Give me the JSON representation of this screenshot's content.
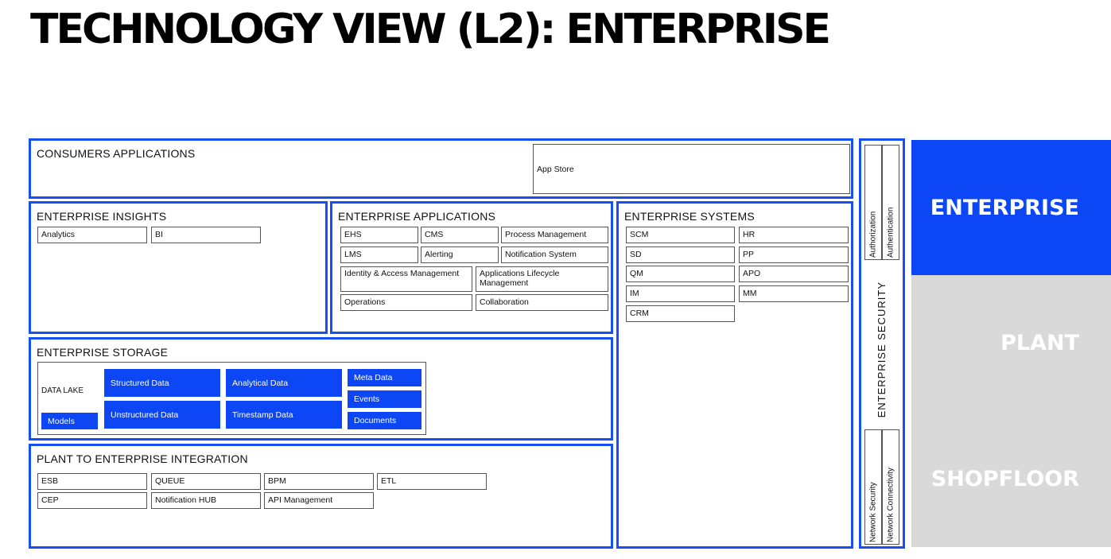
{
  "title": "TECHNOLOGY VIEW (L2): ENTERPRISE",
  "colors": {
    "accent": "#1550f0",
    "filled_block": "#0d47f5",
    "inactive_band": "#d9d9d9"
  },
  "consumers": {
    "title": "CONSUMERS APPLICATIONS",
    "app_store": "App Store"
  },
  "insights": {
    "title": "ENTERPRISE INSIGHTS",
    "items": [
      "Analytics",
      "BI"
    ]
  },
  "applications": {
    "title": "ENTERPRISE APPLICATIONS",
    "items": [
      "EHS",
      "CMS",
      "Process Management",
      "LMS",
      "Alerting",
      "Notification System",
      "Identity & Access Management",
      "Applications Lifecycle Management",
      "Operations",
      "Collaboration"
    ]
  },
  "systems": {
    "title": "ENTERPRISE SYSTEMS",
    "items": [
      "SCM",
      "HR",
      "SD",
      "PP",
      "QM",
      "APO",
      "IM",
      "MM",
      "CRM"
    ]
  },
  "storage": {
    "title": "ENTERPRISE STORAGE",
    "data_lake": "DATA LAKE",
    "models": "Models",
    "blocks": [
      "Structured Data",
      "Analytical Data",
      "Unstructured Data",
      "Timestamp Data"
    ],
    "small_blocks": [
      "Meta Data",
      "Events",
      "Documents"
    ]
  },
  "integration": {
    "title": "PLANT TO ENTERPRISE INTEGRATION",
    "items": [
      "ESB",
      "QUEUE",
      "BPM",
      "ETL",
      "CEP",
      "Notification HUB",
      "API Management"
    ]
  },
  "security": {
    "title": "ENTERPRISE SECURITY",
    "top": [
      "Authorization",
      "Authentication"
    ],
    "bottom": [
      "Network Security",
      "Network Connectivity"
    ]
  },
  "levels": [
    {
      "label": "ENTERPRISE",
      "active": true
    },
    {
      "label": "PLANT",
      "active": false
    },
    {
      "label": "SHOPFLOOR",
      "active": false
    }
  ]
}
